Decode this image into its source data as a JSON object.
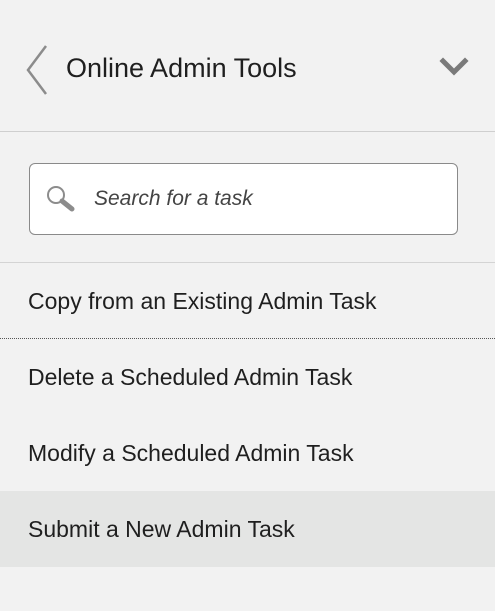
{
  "header": {
    "title": "Online Admin Tools",
    "back_icon": "chevron-left-icon",
    "menu_icon": "chevron-down-icon"
  },
  "search": {
    "placeholder": "Search for a task",
    "value": "",
    "icon": "search-icon"
  },
  "tasks": [
    {
      "label": "Copy from an Existing Admin Task",
      "selected": false
    },
    {
      "label": "Delete a Scheduled Admin Task",
      "selected": false
    },
    {
      "label": "Modify a Scheduled Admin Task",
      "selected": false
    },
    {
      "label": "Submit a New Admin Task",
      "selected": true
    }
  ],
  "colors": {
    "background": "#f2f2f2",
    "selected_row": "#e4e5e4",
    "text": "#1f1f1f",
    "icon": "#8c8c8c"
  }
}
